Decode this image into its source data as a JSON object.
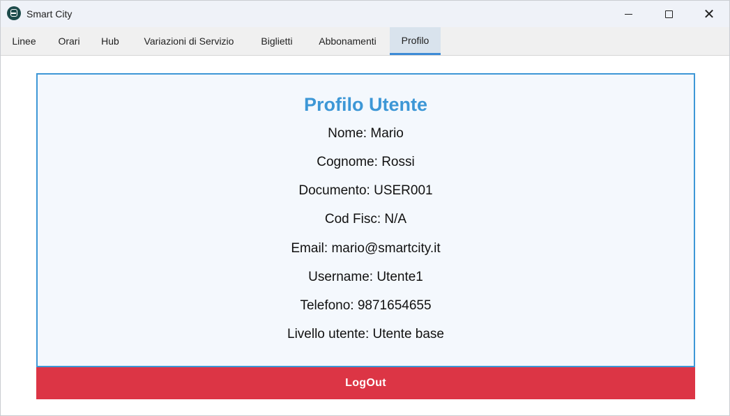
{
  "window": {
    "title": "Smart City"
  },
  "tabs": [
    {
      "label": "Linee"
    },
    {
      "label": "Orari"
    },
    {
      "label": "Hub"
    },
    {
      "label": "Variazioni di Servizio"
    },
    {
      "label": "Biglietti"
    },
    {
      "label": "Abbonamenti"
    },
    {
      "label": "Profilo",
      "active": true
    }
  ],
  "profile": {
    "title": "Profilo Utente",
    "fields": [
      "Nome: Mario",
      "Cognome: Rossi",
      "Documento: USER001",
      "Cod Fisc: N/A",
      "Email: mario@smartcity.it",
      "Username: Utente1",
      "Telefono: 9871654655",
      "Livello utente: Utente base"
    ],
    "logout_label": "LogOut"
  },
  "colors": {
    "accent": "#3d97d6",
    "logout": "#dc3545",
    "panel_bg": "#f4f8fd"
  },
  "icons": {
    "app": "bus-icon",
    "minimize": "minimize-icon",
    "maximize": "maximize-icon",
    "close": "close-icon"
  }
}
